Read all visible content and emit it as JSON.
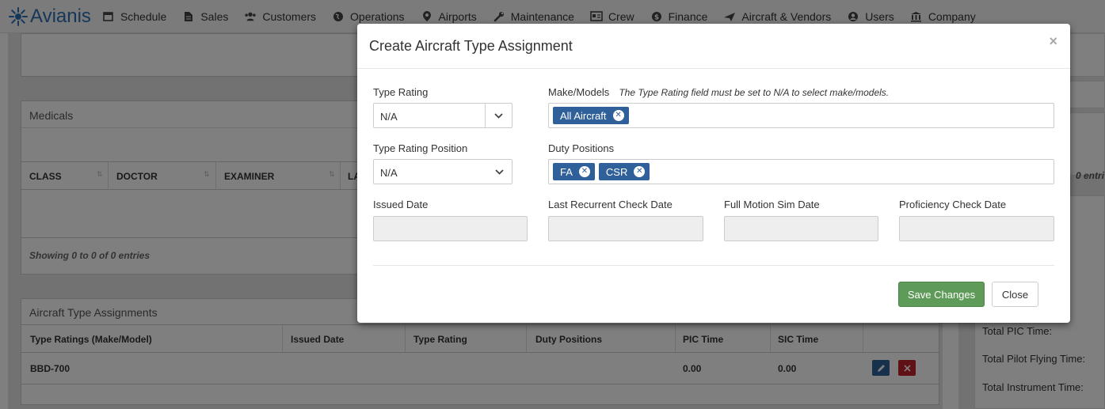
{
  "nav": {
    "brand": "Avianis",
    "items": [
      {
        "label": "Schedule",
        "icon": "calendar-icon"
      },
      {
        "label": "Sales",
        "icon": "document-icon"
      },
      {
        "label": "Customers",
        "icon": "users-icon"
      },
      {
        "label": "Operations",
        "icon": "globe-icon"
      },
      {
        "label": "Airports",
        "icon": "map-pin-icon"
      },
      {
        "label": "Maintenance",
        "icon": "wrench-icon"
      },
      {
        "label": "Crew",
        "icon": "id-card-icon"
      },
      {
        "label": "Finance",
        "icon": "dollar-icon"
      },
      {
        "label": "Aircraft & Vendors",
        "icon": "plane-icon"
      },
      {
        "label": "Users",
        "icon": "user-circle-icon"
      },
      {
        "label": "Company",
        "icon": "building-icon"
      }
    ]
  },
  "background": {
    "medicals_title": "Medicals",
    "medicals_columns": [
      "CLASS",
      "DOCTOR",
      "EXAMINER",
      "LA"
    ],
    "showing_text": "Showing 0 to 0 of 0 entries",
    "ata_title": "Aircraft Type Assignments",
    "ata_columns": [
      "Type Ratings (Make/Model)",
      "Issued Date",
      "Type Rating",
      "Duty Positions",
      "PIC Time",
      "SIC Time"
    ],
    "ata_row": {
      "make_model": "BBD-700",
      "pic": "0.00",
      "sic": "0.00"
    },
    "right_entries_fragment": "0 entri",
    "right_labels": [
      "Total PIC Time:",
      "Total Pilot Flying Time:",
      "Total Instrument Time:"
    ]
  },
  "modal": {
    "title": "Create Aircraft Type Assignment",
    "close_symbol": "×",
    "type_rating_label": "Type Rating",
    "type_rating_value": "N/A",
    "make_models_label": "Make/Models",
    "make_models_note": "The Type Rating field must be set to N/A to select make/models.",
    "make_model_tags": [
      "All Aircraft"
    ],
    "type_rating_position_label": "Type Rating Position",
    "type_rating_position_value": "N/A",
    "duty_positions_label": "Duty Positions",
    "duty_position_tags": [
      "FA",
      "CSR"
    ],
    "issued_date_label": "Issued Date",
    "last_recurrent_label": "Last Recurrent Check Date",
    "full_motion_label": "Full Motion Sim Date",
    "proficiency_label": "Proficiency Check Date",
    "save_label": "Save Changes",
    "close_label": "Close"
  },
  "colors": {
    "brand": "#2f6eb5",
    "tag": "#2f6099",
    "save": "#5e9a58",
    "edit": "#2f6099",
    "delete": "#c0232c"
  }
}
